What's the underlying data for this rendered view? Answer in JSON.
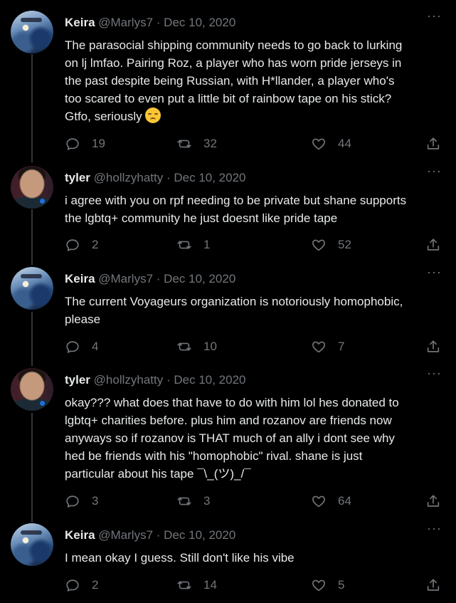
{
  "tweets": [
    {
      "name": "Keira",
      "handle": "@Marlys7",
      "separator": "·",
      "date": "Dec 10, 2020",
      "lines": [
        "The parasocial shipping community needs to go back to lurking",
        "on lj lmfao. Pairing Roz, a player who has worn pride jerseys in",
        "the past despite being Russian, with H*llander, a player who's",
        "too scared to even put a little bit of rainbow tape on his stick?",
        "Gtfo, seriously"
      ],
      "emoji": "unamused-face",
      "replies": "19",
      "retweets": "32",
      "likes": "44"
    },
    {
      "name": "tyler",
      "handle": "@hollzyhatty",
      "separator": "·",
      "date": "Dec 10, 2020",
      "lines": [
        "i agree with you on rpf needing to be private but shane supports",
        "the lgbtq+ community he just doesnt like pride tape"
      ],
      "replies": "2",
      "retweets": "1",
      "likes": "52"
    },
    {
      "name": "Keira",
      "handle": "@Marlys7",
      "separator": "·",
      "date": "Dec 10, 2020",
      "lines": [
        "The current Voyageurs organization is notoriously homophobic,",
        "please"
      ],
      "replies": "4",
      "retweets": "10",
      "likes": "7"
    },
    {
      "name": "tyler",
      "handle": "@hollzyhatty",
      "separator": "·",
      "date": "Dec 10, 2020",
      "lines": [
        "okay??? what does that have to do with him lol hes donated to",
        "lgbtq+ charities before. plus him and rozanov are friends now",
        "anyways so if rozanov is THAT much of an ally i dont see why",
        "hed be friends with his \"homophobic\" rival. shane is just",
        "particular about his tape ¯\\_(ツ)_/¯"
      ],
      "replies": "3",
      "retweets": "3",
      "likes": "64"
    },
    {
      "name": "Keira",
      "handle": "@Marlys7",
      "separator": "·",
      "date": "Dec 10, 2020",
      "lines": [
        "I mean okay I guess. Still don't like his vibe"
      ],
      "replies": "2",
      "retweets": "14",
      "likes": "5"
    }
  ],
  "more_label": "···",
  "colors": {
    "background": "#000000",
    "text": "#e7e9ea",
    "muted": "#71767b",
    "thread_line": "#333639"
  },
  "icons": {
    "reply": "reply-icon",
    "retweet": "retweet-icon",
    "like": "heart-icon",
    "share": "share-icon",
    "more": "more-icon"
  }
}
